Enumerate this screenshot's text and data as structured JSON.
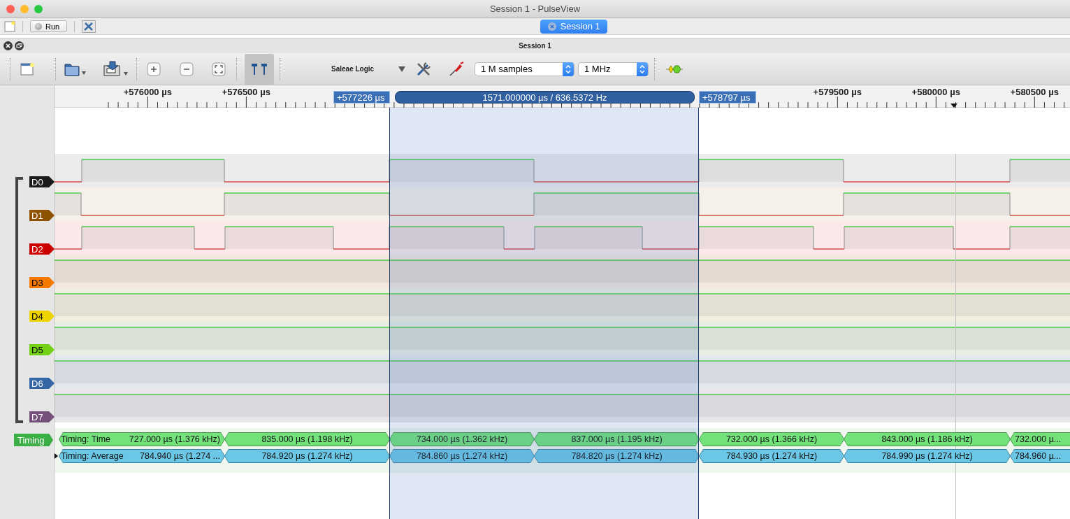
{
  "window": {
    "title": "Session 1 - PulseView"
  },
  "main_toolbar": {
    "run_button": "Run"
  },
  "session_tab": {
    "label": "Session 1",
    "selected": true
  },
  "session_header": {
    "title": "Session 1"
  },
  "device_toolbar": {
    "device": "Saleae Logic",
    "sample_count": "1 M samples",
    "sample_rate": "1 MHz",
    "cursors_on": true
  },
  "ruler": {
    "labels": [
      "+576000 µs",
      "+576500 µs",
      "+579500 µs",
      "+580000 µs",
      "+580500 µs"
    ]
  },
  "cursors": {
    "start": "+577226 µs",
    "end": "+578797 µs",
    "measurement": "1571.000000 µs / 636.5372 Hz"
  },
  "channels": [
    {
      "name": "D0",
      "color": "#1b1b1b"
    },
    {
      "name": "D1",
      "color": "#8f5202"
    },
    {
      "name": "D2",
      "color": "#cc0000"
    },
    {
      "name": "D3",
      "color": "#f57900"
    },
    {
      "name": "D4",
      "color": "#edd400"
    },
    {
      "name": "D5",
      "color": "#73d216"
    },
    {
      "name": "D6",
      "color": "#3465a4"
    },
    {
      "name": "D7",
      "color": "#75507b"
    }
  ],
  "decoder": {
    "name": "Timing",
    "rows": [
      {
        "title": "Timing: Time",
        "kind": "time",
        "segments": [
          "727.000 µs (1.376 kHz)",
          "835.000 µs (1.198 kHz)",
          "734.000 µs (1.362 kHz)",
          "837.000 µs (1.195 kHz)",
          "732.000 µs (1.366 kHz)",
          "843.000 µs (1.186 kHz)",
          "732.000 µ..."
        ]
      },
      {
        "title": "Timing: Average",
        "kind": "average",
        "segments": [
          "784.940 µs (1.274 ...",
          "784.920 µs (1.274 kHz)",
          "784.860 µs (1.274 kHz)",
          "784.820 µs (1.274 kHz)",
          "784.930 µs (1.274 kHz)",
          "784.990 µs (1.274 kHz)",
          "784.960 µ..."
        ]
      }
    ]
  }
}
